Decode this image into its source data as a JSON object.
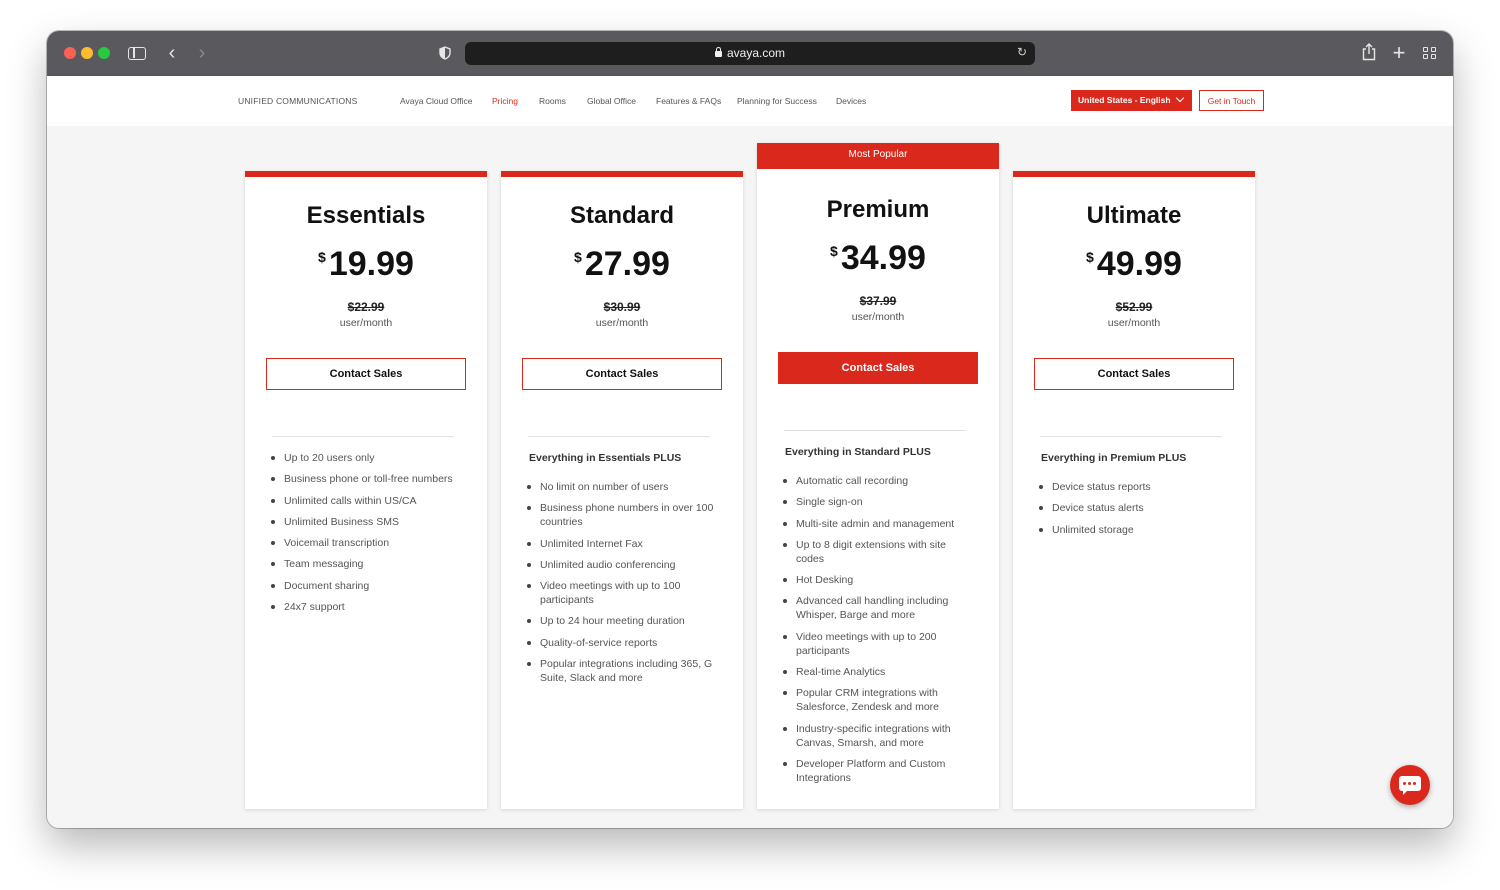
{
  "browser": {
    "url": "avaya.com",
    "icons": [
      "sidebar-icon",
      "back-icon",
      "forward-icon",
      "shield-icon",
      "lock-icon",
      "reload-icon",
      "share-icon",
      "plus-icon",
      "tabs-grid-icon"
    ]
  },
  "nav": {
    "brand": "UNIFIED COMMUNICATIONS",
    "links": [
      "Avaya Cloud Office",
      "Pricing",
      "Rooms",
      "Global Office",
      "Features & FAQs",
      "Planning for Success",
      "Devices"
    ],
    "active": "Pricing",
    "locale": "United States - English",
    "contact": "Get in Touch"
  },
  "accent_color": "#da291c",
  "plans": [
    {
      "name": "Essentials",
      "currency": "$",
      "price": "19.99",
      "old_price": "$22.99",
      "unit": "user/month",
      "cta": "Contact Sales",
      "intro": "",
      "features": [
        "Up to 20 users only",
        "Business phone or toll-free numbers",
        "Unlimited calls within US/CA",
        "Unlimited Business SMS",
        "Voicemail transcription",
        "Team messaging",
        "Document sharing",
        "24x7 support"
      ]
    },
    {
      "name": "Standard",
      "currency": "$",
      "price": "27.99",
      "old_price": "$30.99",
      "unit": "user/month",
      "cta": "Contact Sales",
      "intro": "Everything in Essentials PLUS",
      "features": [
        "No limit on number of users",
        "Business phone numbers in over 100 countries",
        "Unlimited Internet Fax",
        "Unlimited audio conferencing",
        "Video meetings with up to 100 participants",
        "Up to 24 hour meeting duration",
        "Quality-of-service reports",
        "Popular integrations including 365, G Suite, Slack and more"
      ]
    },
    {
      "name": "Premium",
      "badge": "Most Popular",
      "currency": "$",
      "price": "34.99",
      "old_price": "$37.99",
      "unit": "user/month",
      "cta": "Contact Sales",
      "intro": "Everything in Standard PLUS",
      "features": [
        "Automatic call recording",
        "Single sign-on",
        "Multi-site admin and management",
        "Up to 8 digit extensions with site codes",
        "Hot Desking",
        "Advanced call handling including Whisper, Barge and more",
        "Video meetings with up to 200 participants",
        "Real-time Analytics",
        "Popular CRM integrations with Salesforce, Zendesk and more",
        "Industry-specific integrations with Canvas, Smarsh, and more",
        "Developer Platform and Custom Integrations"
      ]
    },
    {
      "name": "Ultimate",
      "currency": "$",
      "price": "49.99",
      "old_price": "$52.99",
      "unit": "user/month",
      "cta": "Contact Sales",
      "intro": "Everything in Premium PLUS",
      "features": [
        "Device status reports",
        "Device status alerts",
        "Unlimited storage"
      ]
    }
  ],
  "chat": {
    "icon": "chat-icon"
  }
}
